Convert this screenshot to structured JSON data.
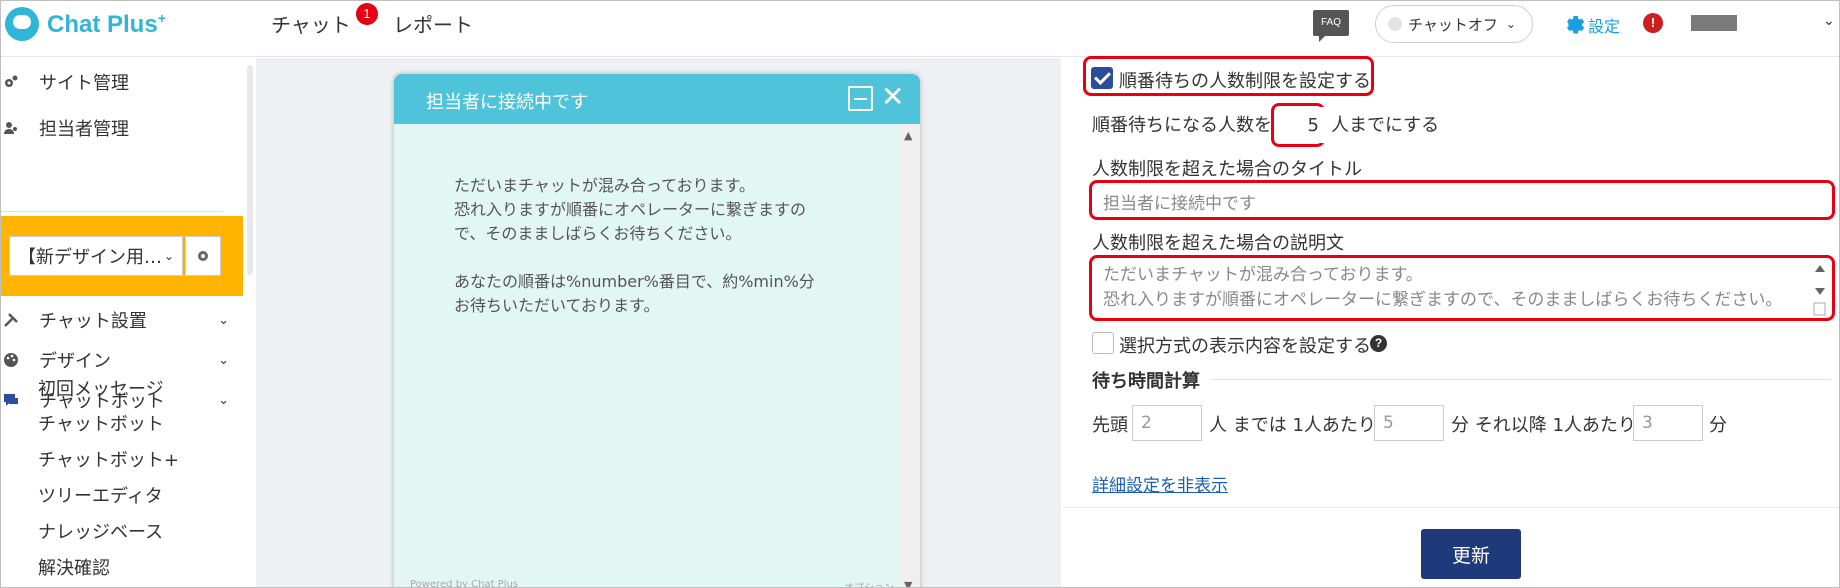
{
  "header": {
    "logo_text": "Chat Plus",
    "logo_sup": "+",
    "nav_chat": "チャット",
    "nav_chat_badge": "1",
    "nav_report": "レポート",
    "faq_label": "FAQ",
    "status_label": "チャットオフ",
    "settings_label": "設定",
    "alert_symbol": "!"
  },
  "sidebar": {
    "items": [
      {
        "label": "サイト管理",
        "icon": "gears-icon"
      },
      {
        "label": "担当者管理",
        "icon": "users-icon"
      }
    ],
    "site_select": "【新デザイン用…",
    "menu": [
      {
        "label": "チャット設置",
        "icon": "tools-icon"
      },
      {
        "label": "デザイン",
        "icon": "palette-icon"
      },
      {
        "label": "チャットボット",
        "icon": "chat-bubble-icon"
      }
    ],
    "sub_items": [
      "初回メッセージ",
      "チャットボット",
      "チャットボット+",
      "ツリーエディタ",
      "ナレッジベース",
      "解決確認"
    ]
  },
  "preview": {
    "title": "担当者に接続中です",
    "message1": "ただいまチャットが混み合っております。\n恐れ入りますが順番にオペレーターに繋ぎますの\nで、そのまましばらくお待ちください。",
    "message2": "あなたの順番は%number%番目で、約%min%分\nお待ちいただいております。",
    "footer": "Powered by Chat Plus",
    "option": "オプション"
  },
  "settings": {
    "limit_checkbox_label": "順番待ちの人数制限を設定する",
    "limit_prefix": "順番待ちになる人数を",
    "limit_value": "5",
    "limit_suffix": "人までにする",
    "title_label": "人数制限を超えた場合のタイトル",
    "title_value": "担当者に接続中です",
    "desc_label": "人数制限を超えた場合の説明文",
    "desc_value": "ただいまチャットが混み合っております。\n恐れ入りますが順番にオペレーターに繋ぎますので、そのまましばらくお待ちください。",
    "choice_label": "選択方式の表示内容を設定する",
    "help_symbol": "?",
    "wait_title": "待ち時間計算",
    "wait_head_label": "先頭",
    "wait_head_value": "2",
    "wait_until_label": "人 までは 1人あたり",
    "wait_per_value": "5",
    "wait_after_label": "分 それ以降 1人あたり",
    "wait_after_value": "3",
    "wait_unit": "分",
    "detail_link": "詳細設定を非表示",
    "update_button": "更新"
  },
  "colors": {
    "brand": "#2fb6d6",
    "highlight": "#ffb400",
    "chat_header": "#4fc3d9",
    "alert_red": "#e60012",
    "button_navy": "#1e3a7a"
  }
}
